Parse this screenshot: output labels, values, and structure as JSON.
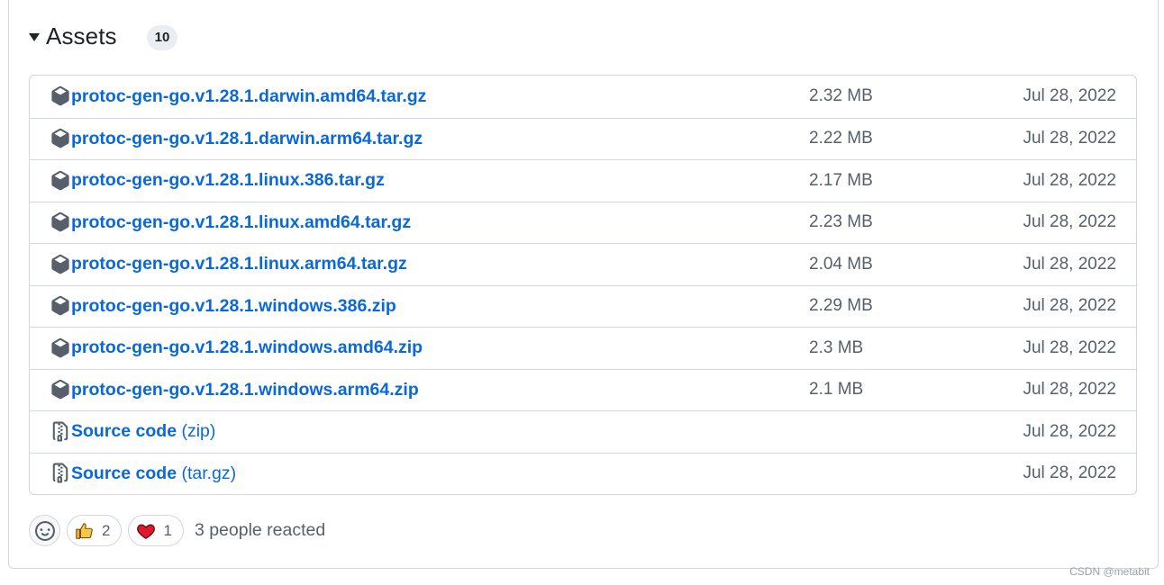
{
  "assets": {
    "title": "Assets",
    "count": "10",
    "items": [
      {
        "name": "protoc-gen-go.v1.28.1.darwin.amd64.tar.gz",
        "size": "2.32 MB",
        "date": "Jul 28, 2022",
        "icon": "package-icon"
      },
      {
        "name": "protoc-gen-go.v1.28.1.darwin.arm64.tar.gz",
        "size": "2.22 MB",
        "date": "Jul 28, 2022",
        "icon": "package-icon"
      },
      {
        "name": "protoc-gen-go.v1.28.1.linux.386.tar.gz",
        "size": "2.17 MB",
        "date": "Jul 28, 2022",
        "icon": "package-icon"
      },
      {
        "name": "protoc-gen-go.v1.28.1.linux.amd64.tar.gz",
        "size": "2.23 MB",
        "date": "Jul 28, 2022",
        "icon": "package-icon"
      },
      {
        "name": "protoc-gen-go.v1.28.1.linux.arm64.tar.gz",
        "size": "2.04 MB",
        "date": "Jul 28, 2022",
        "icon": "package-icon"
      },
      {
        "name": "protoc-gen-go.v1.28.1.windows.386.zip",
        "size": "2.29 MB",
        "date": "Jul 28, 2022",
        "icon": "package-icon"
      },
      {
        "name": "protoc-gen-go.v1.28.1.windows.amd64.zip",
        "size": "2.3 MB",
        "date": "Jul 28, 2022",
        "icon": "package-icon"
      },
      {
        "name": "protoc-gen-go.v1.28.1.windows.arm64.zip",
        "size": "2.1 MB",
        "date": "Jul 28, 2022",
        "icon": "package-icon"
      },
      {
        "name": "Source code",
        "suffix": "(zip)",
        "size": "",
        "date": "Jul 28, 2022",
        "icon": "file-zip-icon"
      },
      {
        "name": "Source code",
        "suffix": "(tar.gz)",
        "size": "",
        "date": "Jul 28, 2022",
        "icon": "file-zip-icon"
      }
    ]
  },
  "reactions": {
    "thumbs_up_count": "2",
    "heart_count": "1",
    "summary": "3 people reacted"
  },
  "watermark": "CSDN @metabit",
  "colors": {
    "link": "#0969da",
    "muted": "#57606a",
    "border": "#d0d7de",
    "badge_bg": "#eaeef2"
  }
}
